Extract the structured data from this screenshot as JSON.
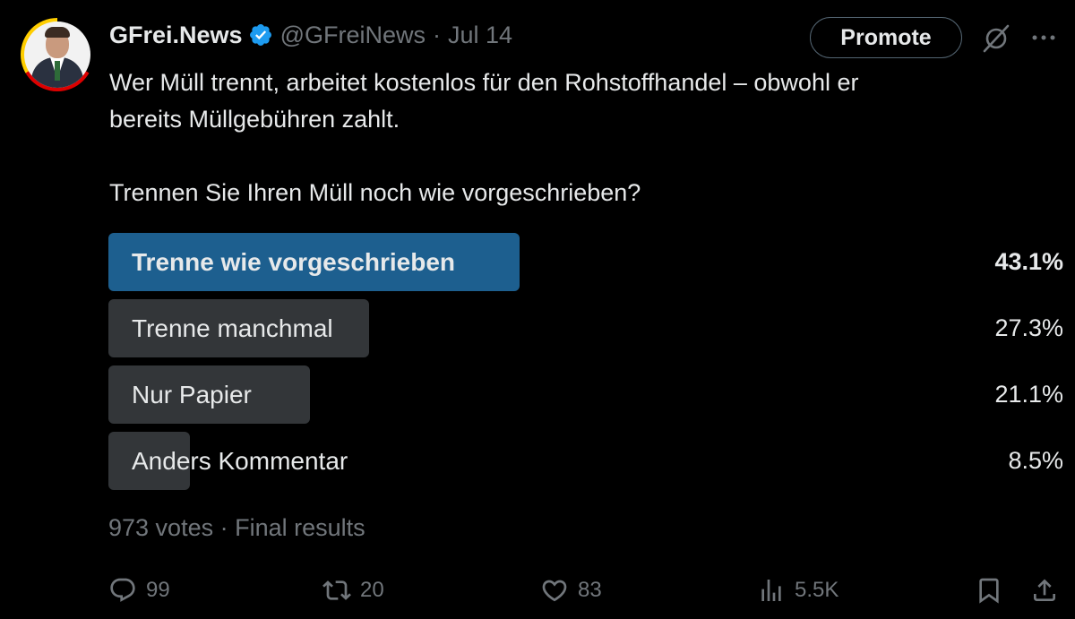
{
  "author": {
    "display_name": "GFrei.News",
    "handle": "@GFreiNews",
    "separator": "·",
    "date": "Jul 14",
    "verified": true
  },
  "header_actions": {
    "promote_label": "Promote",
    "slash_icon": "slash-circle-icon",
    "more_icon": "more-horizontal-icon"
  },
  "tweet": {
    "line1": "Wer Müll trennt, arbeitet kostenlos für den Rohstoffhandel – obwohl er",
    "line2": "bereits Müllgebühren zahlt.",
    "line3": "Trennen Sie Ihren Müll noch wie vorgeschrieben?"
  },
  "poll": {
    "options": [
      {
        "label": "Trenne wie vorgeschrieben",
        "percent": "43.1%",
        "share": 0.431,
        "winner": true
      },
      {
        "label": "Trenne manchmal",
        "percent": "27.3%",
        "share": 0.273,
        "winner": false
      },
      {
        "label": "Nur Papier",
        "percent": "21.1%",
        "share": 0.211,
        "winner": false
      },
      {
        "label": "Anders Kommentar",
        "percent": "8.5%",
        "share": 0.085,
        "winner": false
      }
    ],
    "votes": "973 votes",
    "separator": "·",
    "status": "Final results",
    "winner_color": "#1d5f8f",
    "other_color": "#333639"
  },
  "actions": {
    "replies": "99",
    "reposts": "20",
    "likes": "83",
    "views": "5.5K"
  }
}
